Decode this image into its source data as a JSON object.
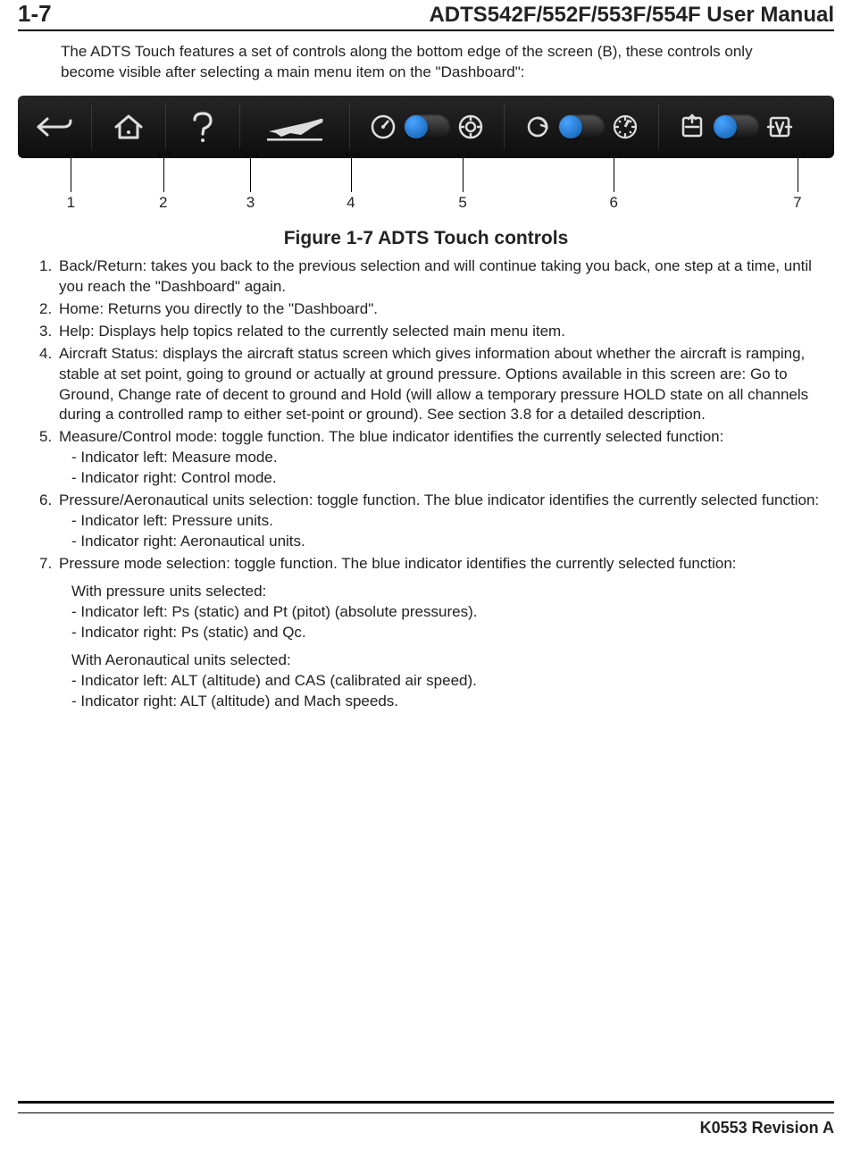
{
  "header": {
    "page_number": "1-7",
    "title": "ADTS542F/552F/553F/554F User Manual"
  },
  "intro": "The ADTS Touch features a set of controls along the bottom edge of the screen (B), these controls only become visible after selecting a main menu item on the \"Dashboard\":",
  "toolbar": {
    "items": [
      {
        "name": "back-icon"
      },
      {
        "name": "home-icon"
      },
      {
        "name": "help-icon"
      },
      {
        "name": "aircraft-status-icon"
      },
      {
        "name": "measure-control-toggle",
        "left_icon": "gauge-icon",
        "right_icon": "controller-icon"
      },
      {
        "name": "units-toggle",
        "left_icon": "circle-arrow-icon",
        "right_icon": "aero-gauge-icon"
      },
      {
        "name": "pressure-mode-toggle",
        "left_icon": "ps-pt-icon",
        "right_icon": "alt-cas-icon"
      }
    ]
  },
  "leaders": [
    {
      "num": "1",
      "left_pct": 6.5
    },
    {
      "num": "2",
      "left_pct": 17.8
    },
    {
      "num": "3",
      "left_pct": 28.5
    },
    {
      "num": "4",
      "left_pct": 40.8
    },
    {
      "num": "5",
      "left_pct": 54.5
    },
    {
      "num": "6",
      "left_pct": 73.0
    },
    {
      "num": "7",
      "left_pct": 95.5
    }
  ],
  "figure_caption": "Figure 1-7 ADTS Touch controls",
  "items": [
    {
      "num": "1.",
      "text": "Back/Return: takes you back to the previous selection and will continue taking you back, one step at a time, until you reach the \"Dashboard\" again."
    },
    {
      "num": "2.",
      "text": "Home: Returns you directly to the \"Dashboard\"."
    },
    {
      "num": "3.",
      "text": "Help: Displays help topics related to the currently selected main menu item."
    },
    {
      "num": "4.",
      "text": "Aircraft Status: displays the aircraft status screen which gives information about whether the aircraft is ramping, stable at set point, going to ground or actually at ground pressure. Options available in this screen are: Go to Ground, Change rate of decent to ground and Hold (will allow a temporary pressure HOLD state on all channels during a controlled ramp to either set-point or ground). See section 3.8 for a detailed description."
    },
    {
      "num": "5.",
      "text": "Measure/Control mode: toggle function. The blue indicator identifies the currently selected function:",
      "subs": [
        "- Indicator left: Measure mode.",
        "- Indicator right: Control mode."
      ]
    },
    {
      "num": "6.",
      "text": "Pressure/Aeronautical units selection: toggle function. The blue indicator identifies the currently selected function:",
      "subs": [
        "- Indicator left: Pressure units.",
        "- Indicator right: Aeronautical units."
      ]
    },
    {
      "num": "7.",
      "text": "Pressure mode selection: toggle function. The blue indicator identifies the currently selected function:",
      "groups": [
        {
          "head": "With pressure units selected:",
          "subs": [
            "- Indicator left: Ps (static) and Pt (pitot) (absolute pressures).",
            "- Indicator right: Ps (static) and Qc."
          ]
        },
        {
          "head": "With Aeronautical units selected:",
          "subs": [
            "- Indicator left: ALT (altitude) and CAS (calibrated air speed).",
            "- Indicator right: ALT (altitude) and Mach speeds."
          ]
        }
      ]
    }
  ],
  "footer": "K0553 Revision A"
}
